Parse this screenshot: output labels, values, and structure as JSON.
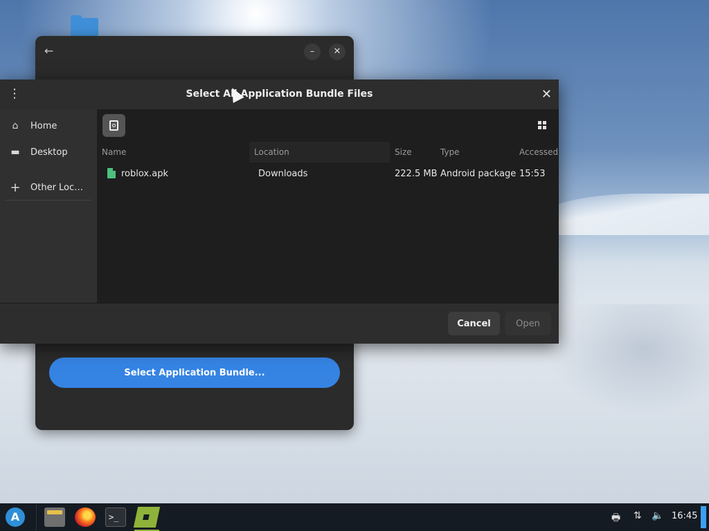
{
  "desktop": {
    "icons": [
      "folder-icon"
    ]
  },
  "background_window": {
    "back_icon": "←",
    "minimize_icon": "–",
    "close_icon": "✕",
    "select_button_label": "Select Application Bundle..."
  },
  "dialog": {
    "title": "Select All Application Bundle Files",
    "menu_icon": "⋮",
    "close_icon": "✕",
    "sidebar": [
      {
        "icon": "⌂",
        "label": "Home"
      },
      {
        "icon": "▬",
        "label": "Desktop"
      },
      {
        "icon": "+",
        "label": "Other Loc…"
      }
    ],
    "columns": {
      "name": "Name",
      "location": "Location",
      "size": "Size",
      "type": "Type",
      "accessed": "Accessed"
    },
    "files": [
      {
        "name": "roblox.apk",
        "location": "Downloads",
        "size": "222.5 MB",
        "type": "Android package",
        "accessed": "15:53"
      }
    ],
    "cancel_label": "Cancel",
    "open_label": "Open"
  },
  "taskbar": {
    "start_icon": "A",
    "apps": [
      "file-manager-icon",
      "firefox-icon",
      "terminal-icon",
      "roblox-icon"
    ],
    "terminal_glyph": ">_",
    "tray": {
      "printer_icon": "🖶",
      "network_icon": "⇅",
      "volume_icon": "🔈",
      "clock": "16:45"
    }
  },
  "colors": {
    "accent": "#3584e4",
    "file_icon": "#4cc07f",
    "roblox": "#8fb33a"
  }
}
